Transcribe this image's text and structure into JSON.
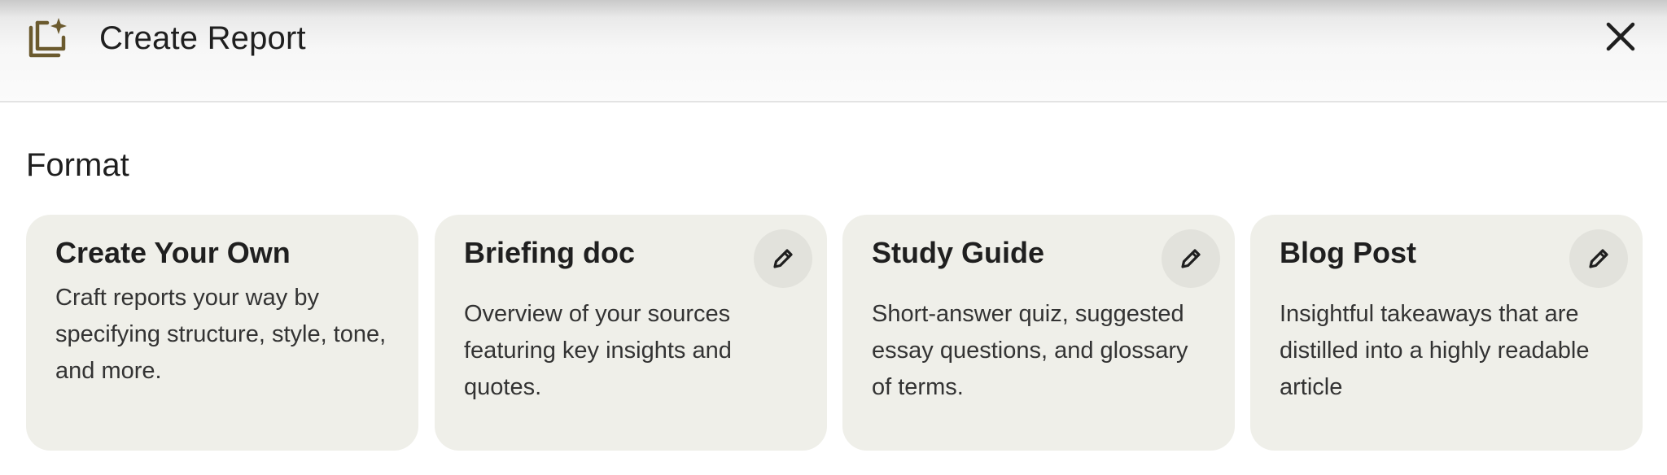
{
  "dialog": {
    "title": "Create Report",
    "icon": "report-sparkle-icon",
    "close_icon": "close-icon"
  },
  "format": {
    "section_title": "Format",
    "cards": [
      {
        "title": "Create Your Own",
        "description": "Craft reports your way by specifying structure, style, tone, and more.",
        "editable": false
      },
      {
        "title": "Briefing doc",
        "description": "Overview of your sources featuring key insights and quotes.",
        "editable": true,
        "edit_icon": "pencil-icon"
      },
      {
        "title": "Study Guide",
        "description": "Short-answer quiz, suggested essay questions, and glossary of terms.",
        "editable": true,
        "edit_icon": "pencil-icon"
      },
      {
        "title": "Blog Post",
        "description": "Insightful takeaways that are distilled into a highly readable article",
        "editable": true,
        "edit_icon": "pencil-icon"
      }
    ]
  },
  "colors": {
    "card_background": "#efefe9",
    "edit_button_background": "#e2e2dc",
    "icon_accent": "#6b5a2e",
    "text_primary": "#1f1f1f"
  }
}
